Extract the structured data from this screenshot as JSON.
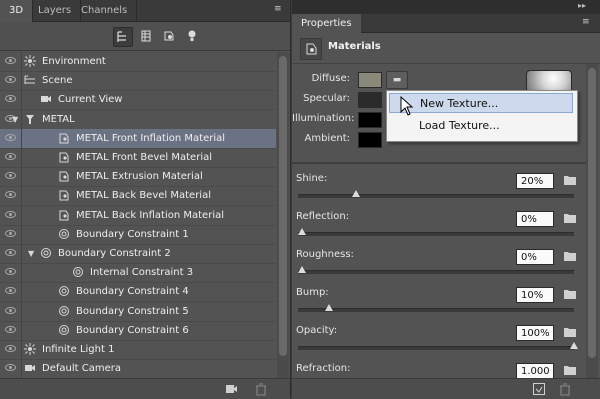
{
  "left_panel": {
    "tabs": [
      "3D",
      "Layers",
      "Channels"
    ],
    "menu_glyph": "▸▸",
    "filters": [
      "whole-scene-icon",
      "meshes-icon",
      "materials-icon",
      "lights-icon"
    ],
    "rows": [
      {
        "label": "Environment",
        "indent": 0,
        "icon": "environment-icon",
        "expand": "",
        "eye": true,
        "selected": false
      },
      {
        "label": "Scene",
        "indent": 0,
        "icon": "scene-icon",
        "expand": "",
        "eye": true,
        "selected": false
      },
      {
        "label": "Current View",
        "indent": 1,
        "icon": "camera-icon",
        "expand": "",
        "eye": true,
        "selected": false
      },
      {
        "label": "METAL",
        "indent": 0,
        "icon": "mesh-icon",
        "expand": "▼",
        "eye": true,
        "selected": false
      },
      {
        "label": "METAL Front Inflation Material",
        "indent": 2,
        "icon": "material-icon",
        "expand": "",
        "eye": true,
        "selected": true
      },
      {
        "label": "METAL Front Bevel Material",
        "indent": 2,
        "icon": "material-icon",
        "expand": "",
        "eye": true,
        "selected": false
      },
      {
        "label": "METAL Extrusion Material",
        "indent": 2,
        "icon": "material-icon",
        "expand": "",
        "eye": true,
        "selected": false
      },
      {
        "label": "METAL Back Bevel Material",
        "indent": 2,
        "icon": "material-icon",
        "expand": "",
        "eye": true,
        "selected": false
      },
      {
        "label": "METAL Back Inflation Material",
        "indent": 2,
        "icon": "material-icon",
        "expand": "",
        "eye": true,
        "selected": false
      },
      {
        "label": "Boundary Constraint 1",
        "indent": 2,
        "icon": "constraint-icon",
        "expand": "",
        "eye": true,
        "selected": false
      },
      {
        "label": "Boundary Constraint 2",
        "indent": 1,
        "icon": "constraint-icon",
        "expand": "▼",
        "eye": true,
        "selected": false
      },
      {
        "label": "Internal Constraint 3",
        "indent": 3,
        "icon": "constraint-icon",
        "expand": "",
        "eye": true,
        "selected": false
      },
      {
        "label": "Boundary Constraint 4",
        "indent": 2,
        "icon": "constraint-icon",
        "expand": "",
        "eye": true,
        "selected": false
      },
      {
        "label": "Boundary Constraint 5",
        "indent": 2,
        "icon": "constraint-icon",
        "expand": "",
        "eye": true,
        "selected": false
      },
      {
        "label": "Boundary Constraint 6",
        "indent": 2,
        "icon": "constraint-icon",
        "expand": "",
        "eye": true,
        "selected": false
      },
      {
        "label": "Infinite Light 1",
        "indent": 0,
        "icon": "light-icon",
        "expand": "",
        "eye": true,
        "selected": false
      },
      {
        "label": "Default Camera",
        "indent": 0,
        "icon": "camera-icon",
        "expand": "",
        "eye": true,
        "selected": false
      }
    ],
    "footer_icons": [
      "new-light-icon",
      "trash-icon"
    ]
  },
  "right_panel": {
    "tab": "Properties",
    "section_title": "Materials",
    "props": [
      {
        "label": "Diffuse:",
        "swatch": "#8a8a7c"
      },
      {
        "label": "Specular:",
        "swatch": "#2b2b2b"
      },
      {
        "label": "Illumination:",
        "swatch": "#000000"
      },
      {
        "label": "Ambient:",
        "swatch": "#000000"
      }
    ],
    "sliders": [
      {
        "label": "Shine:",
        "value": "20%",
        "level": 0.2
      },
      {
        "label": "Reflection:",
        "value": "0%",
        "level": 0.0
      },
      {
        "label": "Roughness:",
        "value": "0%",
        "level": 0.0
      },
      {
        "label": "Bump:",
        "value": "10%",
        "level": 0.1
      },
      {
        "label": "Opacity:",
        "value": "100%",
        "level": 1.0
      },
      {
        "label": "Refraction:",
        "value": "1.000",
        "level": 0.0
      }
    ],
    "dropdown": {
      "items": [
        "New Texture...",
        "Load Texture..."
      ],
      "hover_index": 0
    },
    "footer_icons": [
      "render-icon",
      "trash-icon"
    ]
  }
}
